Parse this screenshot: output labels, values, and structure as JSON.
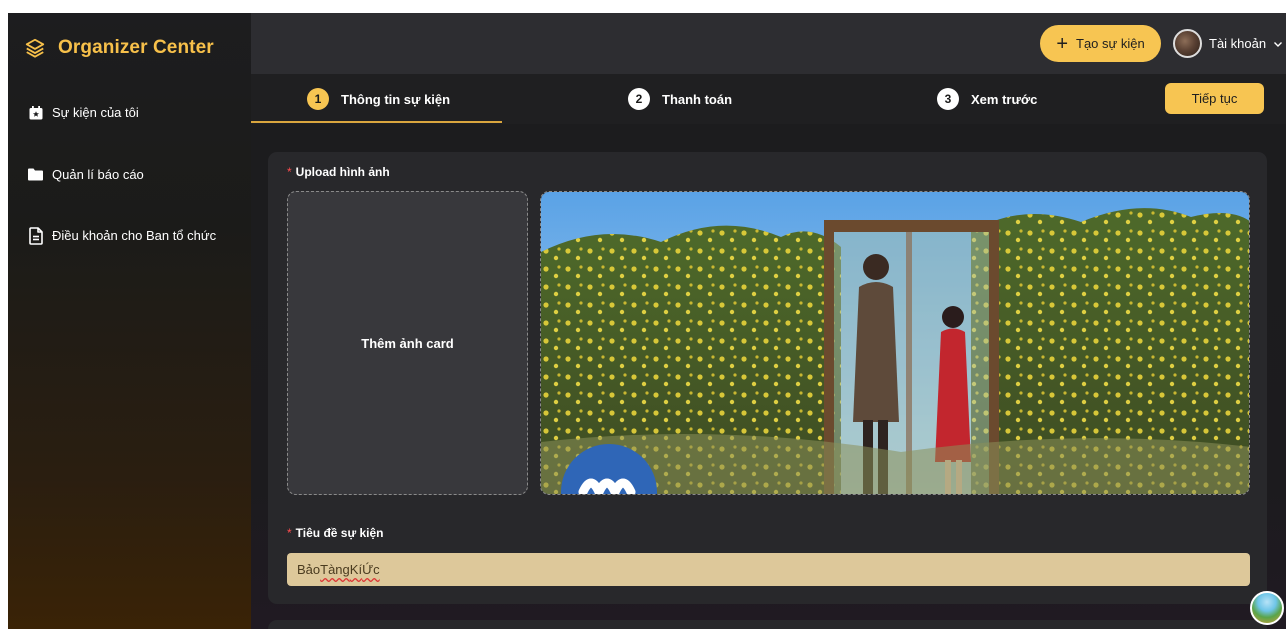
{
  "brand": {
    "name": "Organizer Center",
    "color": "#f7c04a"
  },
  "sidebar": {
    "items": [
      {
        "label": "Sự kiện của tôi",
        "icon": "calendar-star-icon"
      },
      {
        "label": "Quản lí báo cáo",
        "icon": "folder-icon"
      },
      {
        "label": "Điều khoản cho Ban tổ chức",
        "icon": "document-icon"
      }
    ]
  },
  "header": {
    "create_label": "Tạo sự kiện",
    "account_label": "Tài khoản"
  },
  "stepper": {
    "steps": [
      {
        "number": "1",
        "label": "Thông tin sự kiện",
        "active": true
      },
      {
        "number": "2",
        "label": "Thanh toán",
        "active": false
      },
      {
        "number": "3",
        "label": "Xem trước",
        "active": false
      }
    ],
    "continue_label": "Tiếp tục"
  },
  "form": {
    "upload": {
      "label": "Upload hình ảnh",
      "card_placeholder": "Thêm ảnh card"
    },
    "title_field": {
      "label": "Tiêu đề sự kiện",
      "value_parts": [
        "Bảo ",
        "Tàng",
        " ",
        "Kí",
        " ",
        "Ức"
      ]
    }
  },
  "colors": {
    "accent": "#f7c552",
    "required": "#ff4d4f",
    "input_bg": "#ddc89a"
  }
}
